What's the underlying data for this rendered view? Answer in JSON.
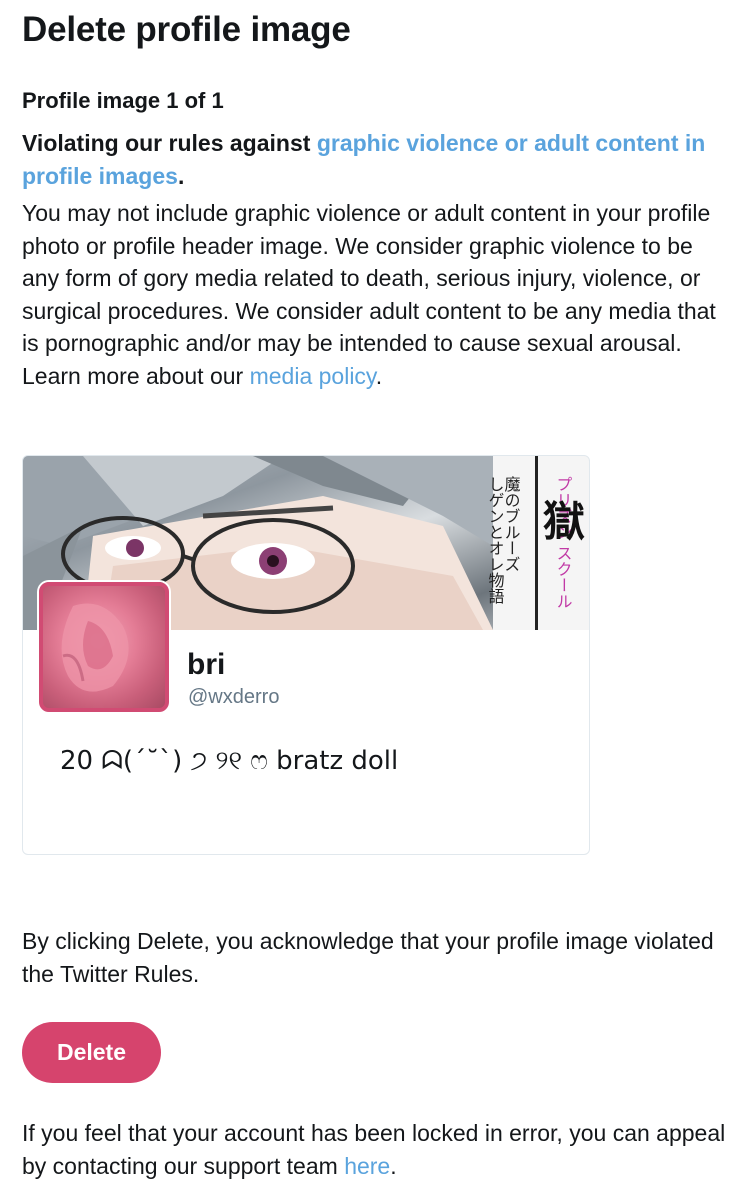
{
  "page": {
    "title": "Delete profile image",
    "image_counter": "Profile image 1 of 1"
  },
  "violation": {
    "prefix": "Violating our rules against ",
    "link_text": "graphic violence or adult content in profile images",
    "suffix": "."
  },
  "policy": {
    "text": "You may not include graphic violence or adult content in your profile photo or profile header image. We consider graphic violence to be any form of gory media related to death, serious injury, violence, or surgical procedures. We consider adult content to be any media that is pornographic and/or may be intended to cause sexual arousal. Learn more about our ",
    "link_text": "media policy",
    "suffix": "."
  },
  "profile": {
    "display_name": "bri",
    "handle": "@wxderro",
    "bio": "20 ᗣ(´˘`) ੭ ୨୧ ෆ bratz doll",
    "header_lettering": "魔のブルーズ しゲンとオレ物語 プリズン スクール 獄"
  },
  "acknowledge_text": "By clicking Delete, you acknowledge that your profile image violated the Twitter Rules.",
  "delete_button": "Delete",
  "appeal": {
    "text": "If you feel that your account has been locked in error, you can appeal by contacting our support team ",
    "link_text": "here",
    "suffix": "."
  },
  "colors": {
    "link": "#5aa3dd",
    "delete_button": "#d6446d",
    "avatar_border": "#d14b73"
  }
}
